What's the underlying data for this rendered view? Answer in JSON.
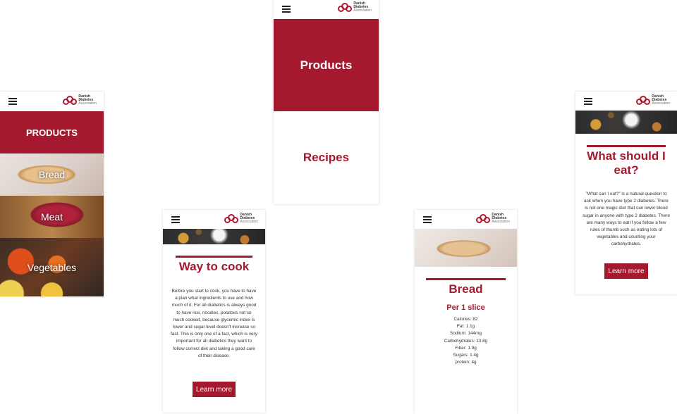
{
  "logo": {
    "line1": "Danish",
    "line2": "Diabetes",
    "line3": "Association"
  },
  "colors": {
    "accent": "#a5192f",
    "background": "#ffffff",
    "text": "#333333"
  },
  "screen_products_list": {
    "header": "PRODUCTS",
    "items": [
      {
        "label": "Bread"
      },
      {
        "label": "Meat"
      },
      {
        "label": "Vegetables"
      }
    ]
  },
  "screen_menu": {
    "item1": "Products",
    "item2": "Recipes"
  },
  "screen_cook": {
    "title": "Way to cook",
    "body": "Before you start to cook, you have to have a plan what ingredients to use and how much of it. For all diabetics is always good to have rice, noodles, potatoes not so much cooked, because glycemic index is lower and sugar level doesn't increase so fast. This is only one of a fact, which is very important for all diabetics they want to follow correct diet and taking a good care of their disease.",
    "button": "Learn more"
  },
  "screen_bread": {
    "title": "Bread",
    "subtitle": "Per 1 slice",
    "nutrition": [
      "Calories: 82",
      "Fat: 1.1g",
      "Sodium: 144mg",
      "Carbohydrates: 13.8g",
      "Fiber: 1.9g",
      "Sugars: 1.4g",
      "protein: 4g"
    ]
  },
  "screen_eat": {
    "title": "What should I eat?",
    "body": "\"What can I eat?\" is a natural question to ask when you have type 2 diabetes. There is not one magic diet that can lower blood sugar in anyone with type 2 diabetes. There are many ways to eat if you follow a few rules of thumb such as eating lots of vegetables and counting your carbohydrates.",
    "button": "Learn more"
  }
}
